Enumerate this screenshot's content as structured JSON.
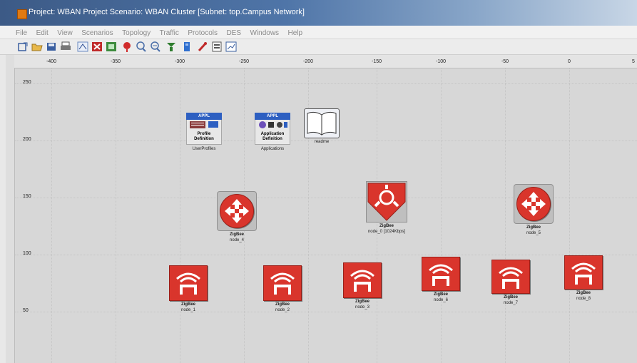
{
  "window": {
    "title": "Project: WBAN   Project Scenario: WBAN  Cluster  [Subnet: top.Campus Network]"
  },
  "menu": [
    {
      "label": "File"
    },
    {
      "label": "Edit"
    },
    {
      "label": "View"
    },
    {
      "label": "Scenarios"
    },
    {
      "label": "Topology"
    },
    {
      "label": "Traffic"
    },
    {
      "label": "Protocols"
    },
    {
      "label": "DES"
    },
    {
      "label": "Windows"
    },
    {
      "label": "Help"
    }
  ],
  "toolbar": [
    {
      "icon": "open-project-icon",
      "color": "#3a5fa0"
    },
    {
      "icon": "open-folder-icon",
      "color": "#d9a52c"
    },
    {
      "icon": "save-icon",
      "color": "#3a5fa0"
    },
    {
      "icon": "print-icon",
      "color": "#555555"
    },
    {
      "icon": "rapid-config-icon",
      "color": "#6a8ac0"
    },
    {
      "icon": "delete-icon",
      "color": "#b32020"
    },
    {
      "icon": "move-icon",
      "color": "#3d8b3d"
    },
    {
      "icon": "fail-node-icon",
      "color": "#d02b2b"
    },
    {
      "icon": "zoom-in-icon",
      "color": "#4a6ea8"
    },
    {
      "icon": "zoom-out-icon",
      "color": "#4a6ea8"
    },
    {
      "icon": "configure-run-icon",
      "color": "#2f7d2f"
    },
    {
      "icon": "view-results-icon",
      "color": "#2f6fcf"
    },
    {
      "icon": "hide-graphs-icon",
      "color": "#c02a2a"
    },
    {
      "icon": "web-report-icon",
      "color": "#555555"
    },
    {
      "icon": "graph-icon",
      "color": "#3a5fa0"
    }
  ],
  "rulers": {
    "x_ticks": [
      "-400",
      "-350",
      "-300",
      "-250",
      "-200",
      "-150",
      "-100",
      "-50",
      "0",
      "5"
    ],
    "y_ticks": [
      "250",
      "200",
      "150",
      "100",
      "50"
    ]
  },
  "nodes": {
    "profiles": {
      "label": "UserProfiles",
      "tag": "APPL",
      "text1": "Profile",
      "text2": "Definition"
    },
    "applications": {
      "label": "Applications",
      "tag": "APPL",
      "text1": "Application",
      "text2": "Definition"
    },
    "readme": {
      "label": "readme"
    },
    "node_4": {
      "label": "node_4",
      "tag": "ZigBee"
    },
    "node_0": {
      "label": "node_0 [1024Kbps]",
      "tag": "ZigBee"
    },
    "node_5": {
      "label": "node_5",
      "tag": "ZigBee"
    },
    "node_1": {
      "label": "node_1",
      "tag": "ZigBee"
    },
    "node_2": {
      "label": "node_2",
      "tag": "ZigBee"
    },
    "node_3": {
      "label": "node_3",
      "tag": "ZigBee"
    },
    "node_6": {
      "label": "node_6",
      "tag": "ZigBee"
    },
    "node_7": {
      "label": "node_7",
      "tag": "ZigBee"
    },
    "node_8": {
      "label": "node_8",
      "tag": "ZigBee"
    }
  },
  "colors": {
    "zigbee_red": "#d9352c",
    "appl_blue": "#2d5fc1"
  }
}
